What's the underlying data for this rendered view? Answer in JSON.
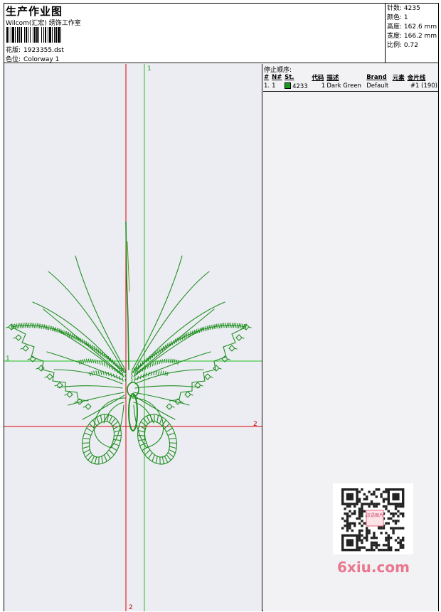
{
  "header": {
    "title": "生产作业图",
    "subtitle": "Wilcom(汇宏) 绣饰工作室",
    "design_label": "花版:",
    "design_value": "1923355.dst",
    "colorway_label": "色位:",
    "colorway_value": "Colorway 1"
  },
  "stats": {
    "stitches_label": "针数:",
    "stitches_value": "4235",
    "colors_label": "颜色:",
    "colors_value": "1",
    "height_label": "高度:",
    "height_value": "162.6 mm",
    "width_label": "宽度:",
    "width_value": "166.2 mm",
    "scale_label": "比例:",
    "scale_value": "0.72"
  },
  "design_area": {
    "marker_v_green": "1",
    "marker_h_green": "1",
    "marker_h_red": "2",
    "marker_v_red": "2",
    "thread_color": "#1f8f1f",
    "red_guide_color": "#e00000",
    "green_guide_color": "#22c022"
  },
  "stops": {
    "header": "停止顺序:",
    "columns": [
      "#",
      "N#",
      "St.",
      "代码",
      "描述",
      "Brand",
      "元素",
      "金片线"
    ],
    "rows": [
      {
        "num": "1.",
        "n": "1",
        "swatch_color": "#1a9a1a",
        "code": "4233",
        "stitches": "1",
        "description": "Dark Green",
        "brand": "Default",
        "element": "",
        "sequin": "#1 (190)"
      }
    ]
  },
  "watermark": {
    "qr_badge": "汉语图片",
    "site": "6xiu.com"
  }
}
